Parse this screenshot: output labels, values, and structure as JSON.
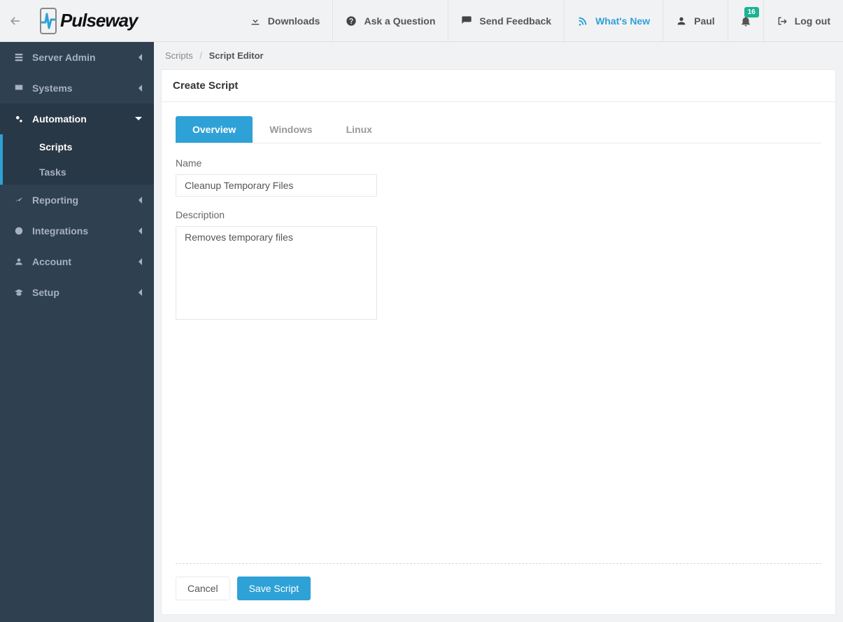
{
  "brand": "Pulseway",
  "topbar": {
    "downloads": "Downloads",
    "ask": "Ask a Question",
    "feedback": "Send Feedback",
    "whatsnew": "What's New",
    "user": "Paul",
    "logout": "Log out",
    "notif_count": "16"
  },
  "sidebar": {
    "server_admin": "Server Admin",
    "systems": "Systems",
    "automation": "Automation",
    "automation_sub": {
      "scripts": "Scripts",
      "tasks": "Tasks"
    },
    "reporting": "Reporting",
    "integrations": "Integrations",
    "account": "Account",
    "setup": "Setup"
  },
  "breadcrumb": {
    "parent": "Scripts",
    "current": "Script Editor"
  },
  "panel": {
    "title": "Create Script",
    "tabs": {
      "overview": "Overview",
      "windows": "Windows",
      "linux": "Linux"
    },
    "form": {
      "name_label": "Name",
      "name_value": "Cleanup Temporary Files",
      "desc_label": "Description",
      "desc_value": "Removes temporary files"
    },
    "buttons": {
      "cancel": "Cancel",
      "save": "Save Script"
    }
  }
}
